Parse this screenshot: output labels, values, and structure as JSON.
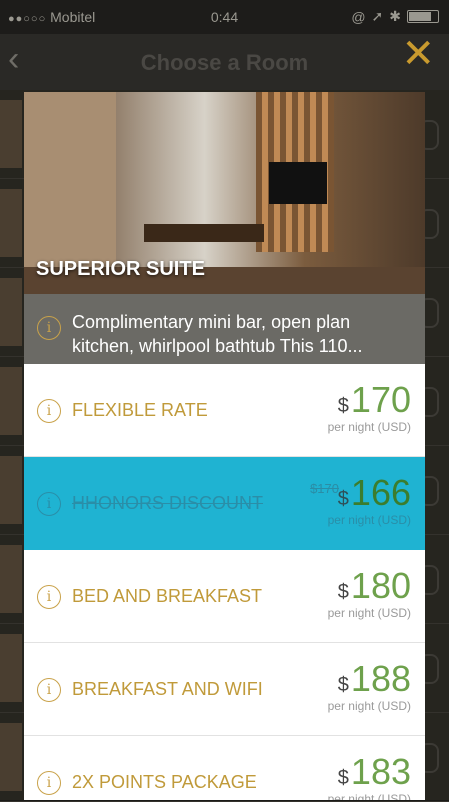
{
  "status_bar": {
    "carrier": "Mobitel",
    "time": "0:44"
  },
  "nav": {
    "back_icon": "chevron-left-icon",
    "title": "Choose a Room",
    "close_icon": "close-icon"
  },
  "modal": {
    "room_name": "SUPERIOR SUITE",
    "description": "Complimentary mini bar, open plan kitchen, whirlpool bathtub This 110...",
    "rates": [
      {
        "label": "FLEXIBLE RATE",
        "currency": "$",
        "price": "170",
        "per": "per night (USD)",
        "old_price": "",
        "selected": false
      },
      {
        "label": "HHONORS DISCOUNT",
        "currency": "$",
        "price": "166",
        "per": "per night (USD)",
        "old_price": "$170",
        "selected": true
      },
      {
        "label": "BED AND BREAKFAST",
        "currency": "$",
        "price": "180",
        "per": "per night (USD)",
        "old_price": "",
        "selected": false
      },
      {
        "label": "BREAKFAST AND WIFI",
        "currency": "$",
        "price": "188",
        "per": "per night (USD)",
        "old_price": "",
        "selected": false
      },
      {
        "label": "2X POINTS PACKAGE",
        "currency": "$",
        "price": "183",
        "per": "per night (USD)",
        "old_price": "",
        "selected": false
      }
    ]
  },
  "colors": {
    "accent_gold": "#c9a24a",
    "price_green": "#6ea14c",
    "selected_blue": "#1fb3d2"
  }
}
